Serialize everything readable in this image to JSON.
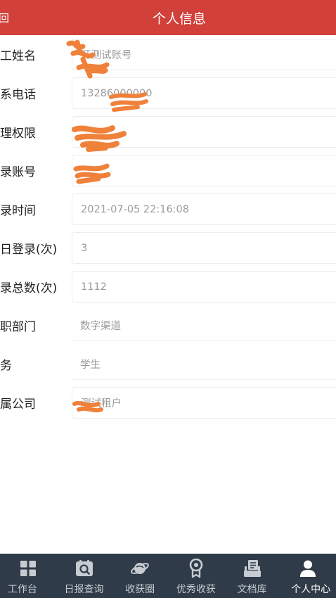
{
  "header": {
    "back_label": "回",
    "title": "个人信息"
  },
  "fields": [
    {
      "label": "工姓名",
      "value": "开测试账号",
      "boxed": true
    },
    {
      "label": "系电话",
      "value": "13286000000",
      "boxed": true
    },
    {
      "label": "理权限",
      "value": "",
      "boxed": true
    },
    {
      "label": "录账号",
      "value": "",
      "boxed": true
    },
    {
      "label": "录时间",
      "value": "2021-07-05 22:16:08",
      "boxed": true
    },
    {
      "label": "日登录(次)",
      "value": "3",
      "boxed": true
    },
    {
      "label": "录总数(次)",
      "value": "1112",
      "boxed": true
    },
    {
      "label": "职部门",
      "value": "数字渠道",
      "boxed": false
    },
    {
      "label": "务",
      "value": "学生",
      "boxed": false
    },
    {
      "label": "属公司",
      "value": "测试租户",
      "boxed": true
    }
  ],
  "tabbar": {
    "items": [
      {
        "label": "工作台",
        "icon": "grid-icon"
      },
      {
        "label": "日报查询",
        "icon": "report-search-icon"
      },
      {
        "label": "收获圈",
        "icon": "planet-icon"
      },
      {
        "label": "优秀收获",
        "icon": "award-icon"
      },
      {
        "label": "文档库",
        "icon": "document-library-icon"
      },
      {
        "label": "个人中心",
        "icon": "person-icon",
        "active": true
      }
    ],
    "active_color": "#ffffff",
    "background": "#2f3b48"
  },
  "colors": {
    "header_bg": "#d2403a",
    "redaction": "#f0813a"
  }
}
